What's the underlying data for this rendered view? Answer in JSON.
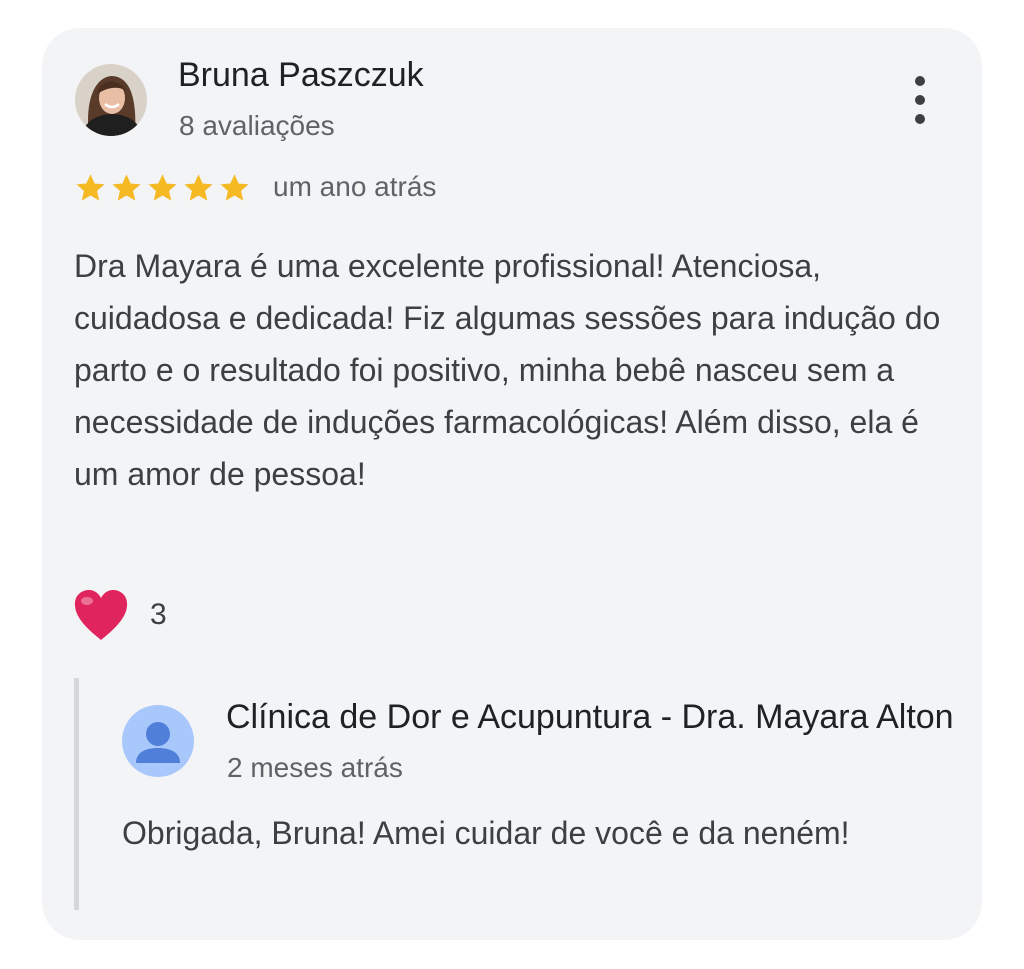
{
  "review": {
    "reviewer_name": "Bruna Paszczuk",
    "reviewer_count": "8 avaliações",
    "rating": 5,
    "rating_max": 5,
    "time": "um ano atrás",
    "text": "Dra Mayara é uma excelente profissional! Atenciosa, cuidadosa e dedicada! Fiz algumas sessões para indução do parto e o resultado foi positivo, minha bebê nasceu sem a necessidade de induções farmacológicas! Além disso, ela é um amor de pessoa!",
    "reaction_icon": "heart-icon",
    "reaction_count": "3"
  },
  "reply": {
    "owner_name": "Clínica de Dor e Acupuntura - Dra. Mayara Alton",
    "time": "2 meses atrás",
    "text": "Obrigada, Bruna! Amei cuidar de você e da neném!"
  },
  "colors": {
    "card_background": "#f3f4f6",
    "star": "#f5b924",
    "heart": "#e0245e",
    "owner_avatar": "#a8c7fa",
    "owner_avatar_figure": "#4f7fd8"
  }
}
